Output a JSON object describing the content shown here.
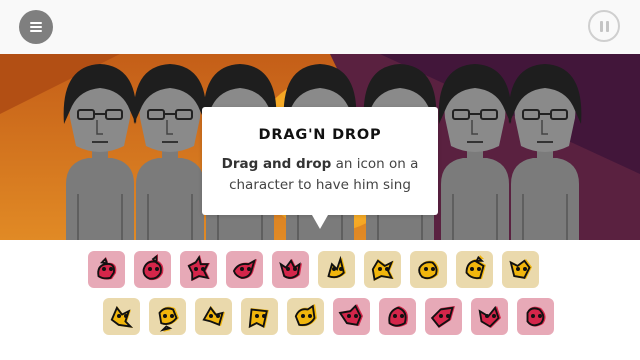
{
  "toolbar": {
    "menu_icon": "menu-icon",
    "pause_icon": "pause-icon"
  },
  "tooltip": {
    "title": "DRAG'N DROP",
    "body_bold": "Drag and drop",
    "body_rest": " an icon on a character to have him sing"
  },
  "characters": {
    "count": 7
  },
  "icons": {
    "row1": [
      {
        "kind": "beat",
        "name": "beat-1-icon"
      },
      {
        "kind": "beat",
        "name": "beat-2-icon"
      },
      {
        "kind": "beat",
        "name": "beat-3-icon"
      },
      {
        "kind": "beat",
        "name": "beat-4-icon"
      },
      {
        "kind": "beat",
        "name": "beat-5-icon"
      },
      {
        "kind": "voice",
        "name": "effect-1-icon"
      },
      {
        "kind": "voice",
        "name": "effect-2-icon"
      },
      {
        "kind": "voice",
        "name": "effect-3-icon"
      },
      {
        "kind": "voice",
        "name": "effect-4-icon"
      },
      {
        "kind": "voice",
        "name": "effect-5-icon"
      }
    ],
    "row2": [
      {
        "kind": "voice",
        "name": "melody-1-icon"
      },
      {
        "kind": "voice",
        "name": "melody-2-icon"
      },
      {
        "kind": "voice",
        "name": "melody-3-icon"
      },
      {
        "kind": "voice",
        "name": "melody-4-icon"
      },
      {
        "kind": "voice",
        "name": "melody-5-icon"
      },
      {
        "kind": "beat",
        "name": "voice-1-icon"
      },
      {
        "kind": "beat",
        "name": "voice-2-icon"
      },
      {
        "kind": "beat",
        "name": "voice-3-icon"
      },
      {
        "kind": "beat",
        "name": "voice-4-icon"
      },
      {
        "kind": "beat",
        "name": "voice-5-icon"
      }
    ]
  },
  "colors": {
    "beat_bg": "#e7a9b7",
    "beat_fg": "#d4264a",
    "voice_bg": "#ead9ac",
    "voice_fg": "#f1b60c",
    "scene_orange": "#d8741c",
    "scene_purple": "#4a1d3c"
  }
}
